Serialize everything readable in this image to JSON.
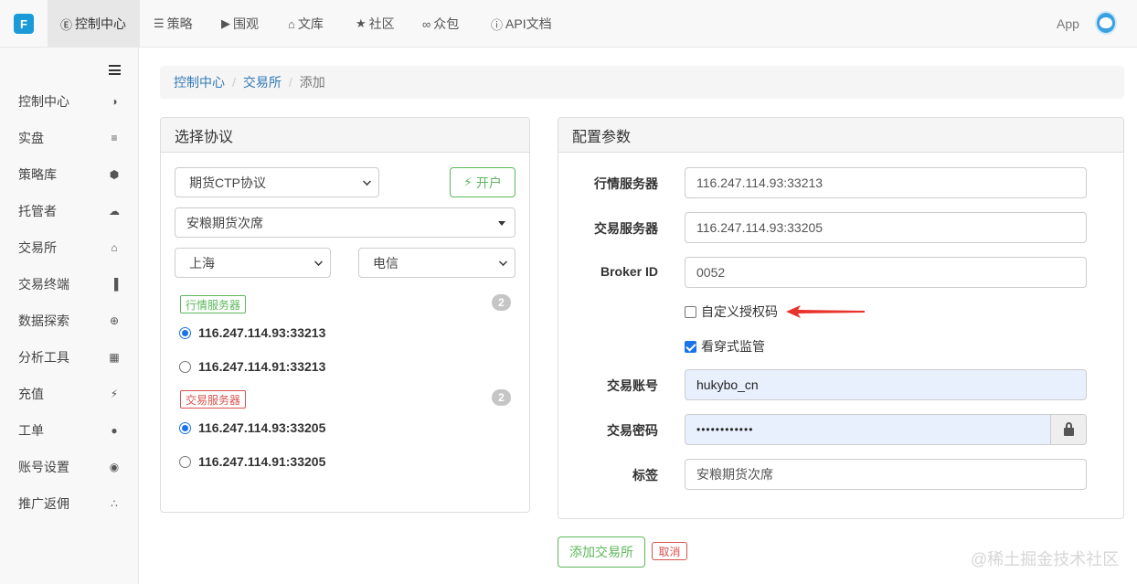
{
  "topnav": {
    "logo_text": "F",
    "items": [
      {
        "icon": "dashboard-icon",
        "glyph": "Ⓔ",
        "label": "控制中心"
      },
      {
        "icon": "cart-icon",
        "glyph": "☰",
        "label": "策略"
      },
      {
        "icon": "play-circle-icon",
        "glyph": "▶",
        "label": "围观"
      },
      {
        "icon": "graduation-cap-icon",
        "glyph": "⌂",
        "label": "文库"
      },
      {
        "icon": "star-icon",
        "glyph": "★",
        "label": "社区"
      },
      {
        "icon": "glasses-icon",
        "glyph": "∞",
        "label": "众包"
      },
      {
        "icon": "info-circle-icon",
        "glyph": "ⓘ",
        "label": "API文档"
      }
    ],
    "app_label": "App"
  },
  "sidebar": {
    "items": [
      {
        "label": "控制中心",
        "icon": "dashboard-icon",
        "glyph": "◑"
      },
      {
        "label": "实盘",
        "icon": "server-icon",
        "glyph": "≡"
      },
      {
        "label": "策略库",
        "icon": "cube-icon",
        "glyph": "⬢"
      },
      {
        "label": "托管者",
        "icon": "cloud-icon",
        "glyph": "☁"
      },
      {
        "label": "交易所",
        "icon": "bank-icon",
        "glyph": "⌂"
      },
      {
        "label": "交易终端",
        "icon": "bar-chart-icon",
        "glyph": "▐"
      },
      {
        "label": "数据探索",
        "icon": "search-plus-icon",
        "glyph": "⊕"
      },
      {
        "label": "分析工具",
        "icon": "calculator-icon",
        "glyph": "▦"
      },
      {
        "label": "充值",
        "icon": "plug-icon",
        "glyph": "⚡"
      },
      {
        "label": "工单",
        "icon": "comment-icon",
        "glyph": "●"
      },
      {
        "label": "账号设置",
        "icon": "user-circle-icon",
        "glyph": "◉"
      },
      {
        "label": "推广返佣",
        "icon": "share-icon",
        "glyph": "∴"
      }
    ]
  },
  "breadcrumb": {
    "items": [
      "控制中心",
      "交易所"
    ],
    "current": "添加",
    "separator": "/"
  },
  "left_panel": {
    "title": "选择协议",
    "protocol_select": "期货CTP协议",
    "open_button": "开户",
    "broker_select": "安粮期货次席",
    "region_select": "上海",
    "carrier_select": "电信",
    "market_server_tag": "行情服务器",
    "market_server_count": "2",
    "market_servers": [
      "116.247.114.93:33213",
      "116.247.114.91:33213"
    ],
    "trade_server_tag": "交易服务器",
    "trade_server_count": "2",
    "trade_servers": [
      "116.247.114.93:33205",
      "116.247.114.91:33205"
    ]
  },
  "right_panel": {
    "title": "配置参数",
    "market_server_label": "行情服务器",
    "market_server_value": "116.247.114.93:33213",
    "trade_server_label": "交易服务器",
    "trade_server_value": "116.247.114.93:33205",
    "broker_id_label": "Broker ID",
    "broker_id_value": "0052",
    "custom_auth_label": "自定义授权码",
    "custom_auth_checked": false,
    "penetration_label": "看穿式监管",
    "penetration_checked": true,
    "account_label": "交易账号",
    "account_value": "hukybo_cn",
    "password_label": "交易密码",
    "password_value": "••••••••••••",
    "tag_label": "标签",
    "tag_value": "安粮期货次席"
  },
  "actions": {
    "add_label": "添加交易所",
    "cancel_label": "取消"
  },
  "colors": {
    "link": "#337ab7",
    "success": "#5cb85c",
    "danger": "#d9534f",
    "arrow": "#e8322b"
  },
  "watermark": "@稀土掘金技术社区"
}
